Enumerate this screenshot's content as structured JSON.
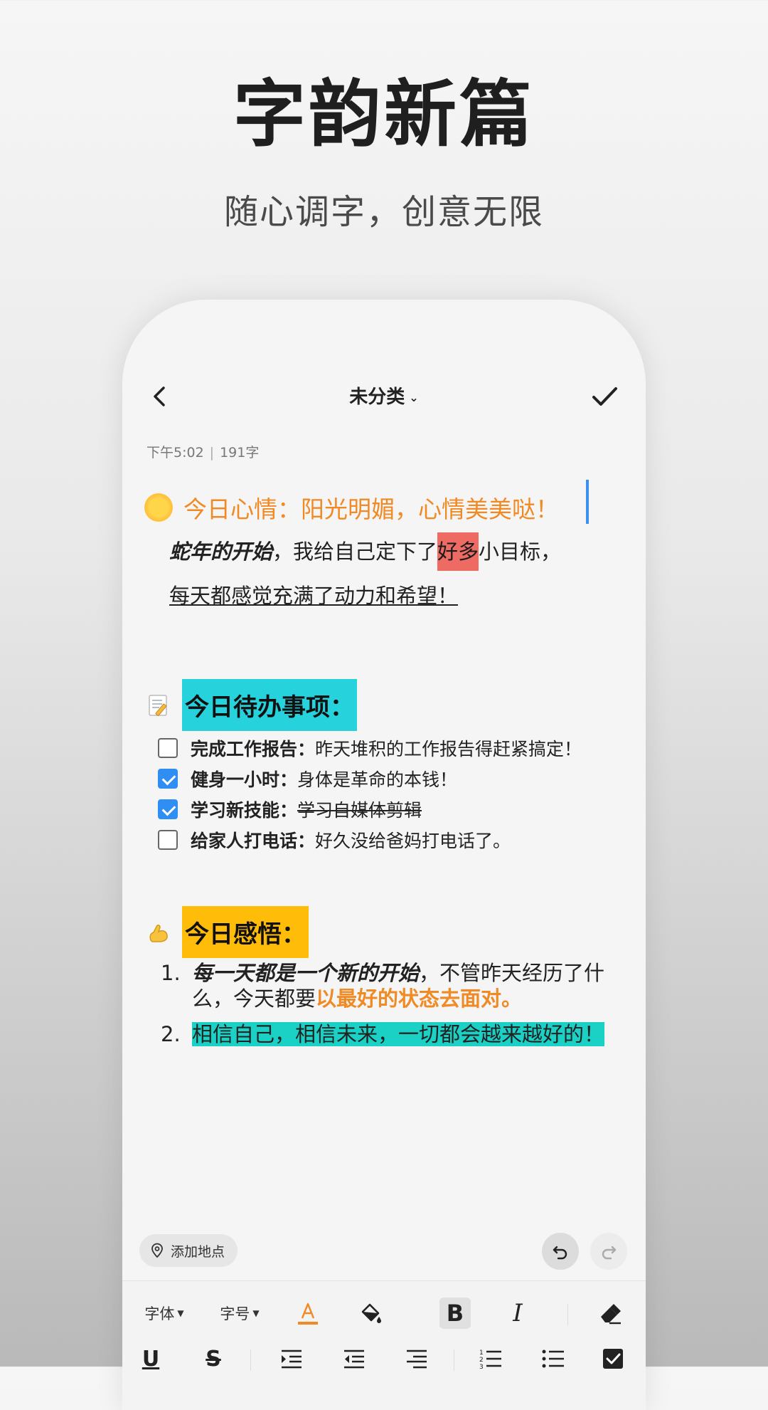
{
  "promo": {
    "title": "字韵新篇",
    "subtitle": "随心调字，创意无限"
  },
  "nav": {
    "category": "未分类",
    "back_icon": "chevron-left-icon",
    "done_icon": "checkmark-icon"
  },
  "meta": {
    "time": "下午5:02",
    "separator": "|",
    "word_count": "191字"
  },
  "note": {
    "mood": "今日心情：阳光明媚，心情美美哒！",
    "para_italic": "蛇年的开始",
    "para_mid": "，我给自己定下了",
    "para_highlight": "好多",
    "para_end": "小目标，",
    "para_line2": "每天都感觉充满了动力和希望！",
    "todo_heading": "今日待办事项：",
    "todos": [
      {
        "title": "完成工作报告：",
        "desc": "昨天堆积的工作报告得赶紧搞定！",
        "checked": false,
        "strike": false
      },
      {
        "title": "健身一小时：",
        "desc": "身体是革命的本钱！",
        "checked": true,
        "strike": false
      },
      {
        "title": "学习新技能：",
        "desc": "学习自媒体剪辑",
        "checked": true,
        "strike": true
      },
      {
        "title": "给家人打电话：",
        "desc": "好久没给爸妈打电话了。",
        "checked": false,
        "strike": false
      }
    ],
    "insight_heading": "今日感悟：",
    "insights": {
      "n1": "1.",
      "i1_bi": "每一天都是一个新的开始",
      "i1_mid": "，不管昨天经历了什么，今天都要",
      "i1_orange": "以最好的状态去面对。",
      "n2": "2.",
      "i2": "相信自己，相信未来，一切都会越来越好的！"
    }
  },
  "bottom": {
    "add_location": "添加地点",
    "undo_icon": "undo-icon",
    "redo_icon": "redo-icon"
  },
  "toolbar": {
    "font_label": "字体",
    "size_label": "字号",
    "bold_label": "B",
    "italic_label": "I",
    "underline_label": "U",
    "strike_label": "S"
  },
  "colors": {
    "accent_orange": "#f08a24",
    "highlight_red": "#ee6b63",
    "todo_heading_bg": "#26d3dc",
    "insight_heading_bg": "#ffbd0a",
    "teal_highlight": "#1bd1c6",
    "check_blue": "#2f8ef4",
    "cursor_blue": "#3d8ff0"
  }
}
